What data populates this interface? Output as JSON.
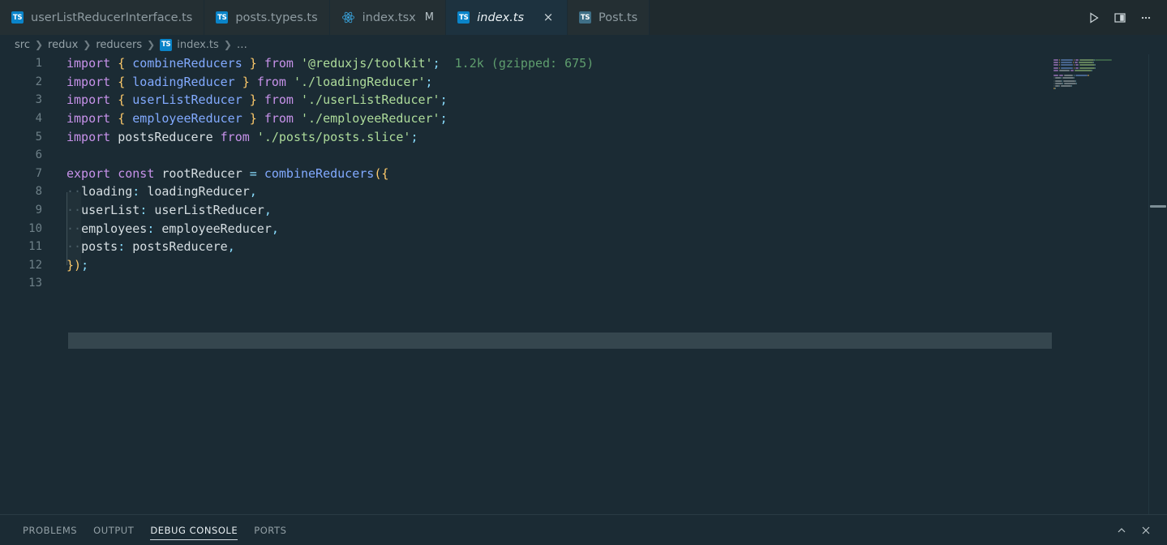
{
  "window": {
    "theme_bg": "#1b2b34",
    "tabbar_bg": "#1f2a2e",
    "active_tab_bg": "#1d323f",
    "accent": "#0a84c9"
  },
  "tabbar": {
    "tabs": [
      {
        "label": "userListReducerInterface.ts",
        "icon": "typescript-file-icon",
        "active": false,
        "modified": "",
        "closable": false
      },
      {
        "label": "posts.types.ts",
        "icon": "typescript-file-icon",
        "active": false,
        "modified": "",
        "closable": false
      },
      {
        "label": "index.tsx",
        "icon": "react-file-icon",
        "active": false,
        "modified": "M",
        "closable": false
      },
      {
        "label": "index.ts",
        "icon": "typescript-file-icon",
        "active": true,
        "modified": "",
        "closable": true
      },
      {
        "label": "Post.ts",
        "icon": "typescript-file-icon",
        "active": false,
        "modified": "",
        "closable": false
      }
    ],
    "close_glyph": "×",
    "actions": [
      {
        "name": "run-button",
        "title": "Run"
      },
      {
        "name": "split-editor-button",
        "title": "Split Editor Right"
      },
      {
        "name": "more-actions-button",
        "title": "More Actions..."
      }
    ]
  },
  "breadcrumb": {
    "separator": "❯",
    "items": [
      {
        "label": "src",
        "icon": ""
      },
      {
        "label": "redux",
        "icon": ""
      },
      {
        "label": "reducers",
        "icon": ""
      },
      {
        "label": "index.ts",
        "icon": "typescript-file-icon"
      },
      {
        "label": "…",
        "icon": ""
      }
    ]
  },
  "editor": {
    "language": "typescript",
    "file_name": "index.ts",
    "first_line": 1,
    "last_line": 13,
    "cursor_line": 13,
    "import_cost_annotation": "1.2k (gzipped: 675)",
    "whitespace_dot": "·",
    "lines": [
      {
        "n": 1,
        "text": "import { combineReducers } from '@reduxjs/toolkit';"
      },
      {
        "n": 2,
        "text": "import { loadingReducer } from './loadingReducer';"
      },
      {
        "n": 3,
        "text": "import { userListReducer } from './userListReducer';"
      },
      {
        "n": 4,
        "text": "import { employeeReducer } from './employeeReducer';"
      },
      {
        "n": 5,
        "text": "import postsReducere from './posts/posts.slice';"
      },
      {
        "n": 6,
        "text": ""
      },
      {
        "n": 7,
        "text": "export const rootReducer = combineReducers({"
      },
      {
        "n": 8,
        "text": "  loading: loadingReducer,"
      },
      {
        "n": 9,
        "text": "  userList: userListReducer,"
      },
      {
        "n": 10,
        "text": "  employees: employeeReducer,"
      },
      {
        "n": 11,
        "text": "  posts: postsReducere,"
      },
      {
        "n": 12,
        "text": "});"
      },
      {
        "n": 13,
        "text": ""
      }
    ],
    "tokens": {
      "l1": [
        {
          "t": "import",
          "c": "kw"
        },
        {
          "t": " ",
          "c": "plain"
        },
        {
          "t": "{",
          "c": "br"
        },
        {
          "t": " ",
          "c": "plain"
        },
        {
          "t": "combineReducers",
          "c": "id"
        },
        {
          "t": " ",
          "c": "plain"
        },
        {
          "t": "}",
          "c": "br"
        },
        {
          "t": " ",
          "c": "plain"
        },
        {
          "t": "from",
          "c": "kw"
        },
        {
          "t": " ",
          "c": "plain"
        },
        {
          "t": "'@reduxjs/toolkit'",
          "c": "str"
        },
        {
          "t": ";",
          "c": "pun"
        },
        {
          "t": "  1.2k (gzipped: 675)",
          "c": "cost"
        }
      ],
      "l2": [
        {
          "t": "import",
          "c": "kw"
        },
        {
          "t": " ",
          "c": "plain"
        },
        {
          "t": "{",
          "c": "br"
        },
        {
          "t": " ",
          "c": "plain"
        },
        {
          "t": "loadingReducer",
          "c": "id"
        },
        {
          "t": " ",
          "c": "plain"
        },
        {
          "t": "}",
          "c": "br"
        },
        {
          "t": " ",
          "c": "plain"
        },
        {
          "t": "from",
          "c": "kw"
        },
        {
          "t": " ",
          "c": "plain"
        },
        {
          "t": "'./loadingReducer'",
          "c": "str"
        },
        {
          "t": ";",
          "c": "pun"
        }
      ],
      "l3": [
        {
          "t": "import",
          "c": "kw"
        },
        {
          "t": " ",
          "c": "plain"
        },
        {
          "t": "{",
          "c": "br"
        },
        {
          "t": " ",
          "c": "plain"
        },
        {
          "t": "userListReducer",
          "c": "id"
        },
        {
          "t": " ",
          "c": "plain"
        },
        {
          "t": "}",
          "c": "br"
        },
        {
          "t": " ",
          "c": "plain"
        },
        {
          "t": "from",
          "c": "kw"
        },
        {
          "t": " ",
          "c": "plain"
        },
        {
          "t": "'./userListReducer'",
          "c": "str"
        },
        {
          "t": ";",
          "c": "pun"
        }
      ],
      "l4": [
        {
          "t": "import",
          "c": "kw"
        },
        {
          "t": " ",
          "c": "plain"
        },
        {
          "t": "{",
          "c": "br"
        },
        {
          "t": " ",
          "c": "plain"
        },
        {
          "t": "employeeReducer",
          "c": "id"
        },
        {
          "t": " ",
          "c": "plain"
        },
        {
          "t": "}",
          "c": "br"
        },
        {
          "t": " ",
          "c": "plain"
        },
        {
          "t": "from",
          "c": "kw"
        },
        {
          "t": " ",
          "c": "plain"
        },
        {
          "t": "'./employeeReducer'",
          "c": "str"
        },
        {
          "t": ";",
          "c": "pun"
        }
      ],
      "l5": [
        {
          "t": "import",
          "c": "kw"
        },
        {
          "t": " ",
          "c": "plain"
        },
        {
          "t": "postsReducere",
          "c": "plain"
        },
        {
          "t": " ",
          "c": "plain"
        },
        {
          "t": "from",
          "c": "kw"
        },
        {
          "t": " ",
          "c": "plain"
        },
        {
          "t": "'./posts/posts.slice'",
          "c": "str"
        },
        {
          "t": ";",
          "c": "pun"
        }
      ],
      "l7": [
        {
          "t": "export",
          "c": "kw"
        },
        {
          "t": " ",
          "c": "plain"
        },
        {
          "t": "const",
          "c": "kw"
        },
        {
          "t": " ",
          "c": "plain"
        },
        {
          "t": "rootReducer",
          "c": "plain"
        },
        {
          "t": " ",
          "c": "plain"
        },
        {
          "t": "=",
          "c": "op"
        },
        {
          "t": " ",
          "c": "plain"
        },
        {
          "t": "combineReducers",
          "c": "fn"
        },
        {
          "t": "(",
          "c": "br"
        },
        {
          "t": "{",
          "c": "br"
        }
      ],
      "l8": [
        {
          "t": "··",
          "c": "ws"
        },
        {
          "t": "loading",
          "c": "plain"
        },
        {
          "t": ":",
          "c": "pun"
        },
        {
          "t": " ",
          "c": "plain"
        },
        {
          "t": "loadingReducer",
          "c": "plain"
        },
        {
          "t": ",",
          "c": "pun"
        }
      ],
      "l9": [
        {
          "t": "··",
          "c": "ws"
        },
        {
          "t": "userList",
          "c": "plain"
        },
        {
          "t": ":",
          "c": "pun"
        },
        {
          "t": " ",
          "c": "plain"
        },
        {
          "t": "userListReducer",
          "c": "plain"
        },
        {
          "t": ",",
          "c": "pun"
        }
      ],
      "l10": [
        {
          "t": "··",
          "c": "ws"
        },
        {
          "t": "employees",
          "c": "plain"
        },
        {
          "t": ":",
          "c": "pun"
        },
        {
          "t": " ",
          "c": "plain"
        },
        {
          "t": "employeeReducer",
          "c": "plain"
        },
        {
          "t": ",",
          "c": "pun"
        }
      ],
      "l11": [
        {
          "t": "··",
          "c": "ws"
        },
        {
          "t": "posts",
          "c": "plain"
        },
        {
          "t": ":",
          "c": "pun"
        },
        {
          "t": " ",
          "c": "plain"
        },
        {
          "t": "postsReducere",
          "c": "plain"
        },
        {
          "t": ",",
          "c": "pun"
        }
      ],
      "l12": [
        {
          "t": "}",
          "c": "br"
        },
        {
          "t": ")",
          "c": "br"
        },
        {
          "t": ";",
          "c": "pun"
        }
      ]
    },
    "minimap": {
      "visible": true,
      "lines": 13
    },
    "scrollbar": {
      "visible": true,
      "mark_at_line": 9
    }
  },
  "panel": {
    "tabs": [
      {
        "label": "PROBLEMS",
        "active": false
      },
      {
        "label": "OUTPUT",
        "active": false
      },
      {
        "label": "DEBUG CONSOLE",
        "active": true
      },
      {
        "label": "PORTS",
        "active": false
      }
    ],
    "actions": [
      {
        "name": "collapse-panel-button",
        "glyph": "ⱏ"
      },
      {
        "name": "close-panel-button",
        "glyph": "✕"
      }
    ]
  }
}
